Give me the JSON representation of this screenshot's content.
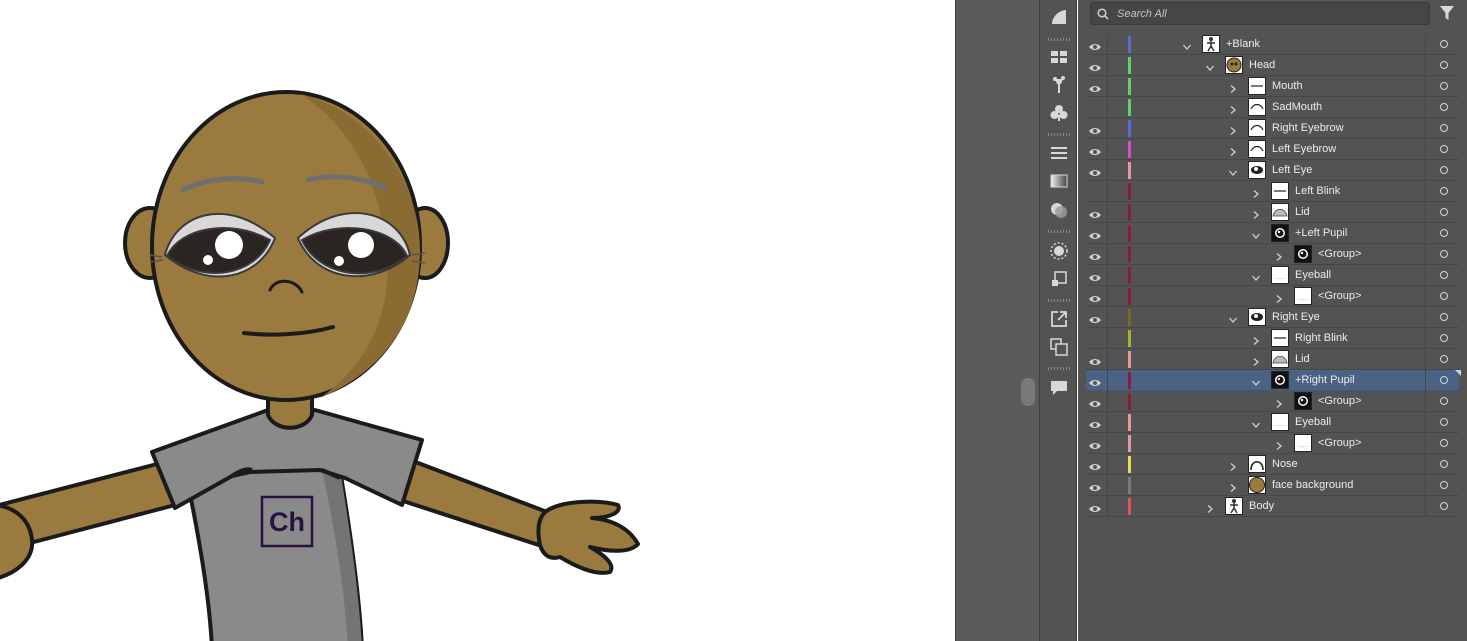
{
  "search": {
    "placeholder": "Search All"
  },
  "shirt_logo": "Ch",
  "icons": {
    "search": "search-icon",
    "filter": "filter-icon",
    "tools": [
      "properties-icon",
      "swatches-icon",
      "brushes-icon",
      "symbols-icon",
      "align-icon",
      "gradient-icon",
      "transparency-icon",
      "appearance-icon",
      "asset-export-icon",
      "export-icon",
      "artboards-icon",
      "comments-icon"
    ]
  },
  "colors": {
    "selected_row": "#4a6283",
    "panel_bg": "#535353",
    "skin": "#9a7a3e",
    "shirt": "#8a8a8a"
  },
  "layers": [
    {
      "name": "+Blank",
      "level": 0,
      "expanded": true,
      "visible": true,
      "color": "#5d6bd6",
      "thumb": "figure",
      "selected": false
    },
    {
      "name": "Head",
      "level": 1,
      "expanded": true,
      "visible": true,
      "color": "#5fd16a",
      "thumb": "head",
      "selected": false
    },
    {
      "name": "Mouth",
      "level": 2,
      "expanded": false,
      "visible": true,
      "color": "#5fd16a",
      "thumb": "line",
      "selected": false
    },
    {
      "name": "SadMouth",
      "level": 2,
      "expanded": false,
      "visible": false,
      "color": "#5fd16a",
      "thumb": "arc",
      "selected": false
    },
    {
      "name": "Right Eyebrow",
      "level": 2,
      "expanded": false,
      "visible": true,
      "color": "#5d6bd6",
      "thumb": "arc",
      "selected": false
    },
    {
      "name": "Left Eyebrow",
      "level": 2,
      "expanded": false,
      "visible": true,
      "color": "#d44fd4",
      "thumb": "arc",
      "selected": false
    },
    {
      "name": "Left Eye",
      "level": 2,
      "expanded": true,
      "visible": true,
      "color": "#e89aa0",
      "thumb": "eye",
      "selected": false
    },
    {
      "name": "Left Blink",
      "level": 3,
      "expanded": false,
      "visible": false,
      "color": "#8c1d3a",
      "thumb": "line",
      "selected": false
    },
    {
      "name": "Lid",
      "level": 3,
      "expanded": false,
      "visible": true,
      "color": "#8c1d3a",
      "thumb": "lid",
      "selected": false
    },
    {
      "name": "+Left Pupil",
      "level": 3,
      "expanded": true,
      "visible": true,
      "color": "#8c1d3a",
      "thumb": "pupil",
      "selected": false
    },
    {
      "name": "<Group>",
      "level": 4,
      "expanded": false,
      "visible": true,
      "color": "#8c1d3a",
      "thumb": "pupil",
      "selected": false
    },
    {
      "name": "Eyeball",
      "level": 3,
      "expanded": true,
      "visible": true,
      "color": "#8c1d3a",
      "thumb": "blank",
      "selected": false
    },
    {
      "name": "<Group>",
      "level": 4,
      "expanded": false,
      "visible": true,
      "color": "#8c1d3a",
      "thumb": "blank",
      "selected": false
    },
    {
      "name": "Right Eye",
      "level": 2,
      "expanded": true,
      "visible": true,
      "color": "#7a6a1e",
      "thumb": "eye",
      "selected": false
    },
    {
      "name": "Right Blink",
      "level": 3,
      "expanded": false,
      "visible": false,
      "color": "#a6b42a",
      "thumb": "line",
      "selected": false
    },
    {
      "name": "Lid",
      "level": 3,
      "expanded": false,
      "visible": true,
      "color": "#e89aa0",
      "thumb": "lid",
      "selected": false
    },
    {
      "name": "+Right Pupil",
      "level": 3,
      "expanded": true,
      "visible": true,
      "color": "#8c1d3a",
      "thumb": "pupil",
      "selected": true
    },
    {
      "name": "<Group>",
      "level": 4,
      "expanded": false,
      "visible": true,
      "color": "#8c1d3a",
      "thumb": "pupil",
      "selected": false
    },
    {
      "name": "Eyeball",
      "level": 3,
      "expanded": true,
      "visible": true,
      "color": "#e89aa0",
      "thumb": "blank",
      "selected": false
    },
    {
      "name": "<Group>",
      "level": 4,
      "expanded": false,
      "visible": true,
      "color": "#e89aa0",
      "thumb": "blank",
      "selected": false
    },
    {
      "name": "Nose",
      "level": 2,
      "expanded": false,
      "visible": true,
      "color": "#e8e04a",
      "thumb": "nose",
      "selected": false
    },
    {
      "name": "face background",
      "level": 2,
      "expanded": false,
      "visible": true,
      "color": "#7a7a7a",
      "thumb": "face",
      "selected": false
    },
    {
      "name": "Body",
      "level": 1,
      "expanded": false,
      "visible": true,
      "color": "#e05555",
      "thumb": "figure",
      "selected": false
    }
  ]
}
